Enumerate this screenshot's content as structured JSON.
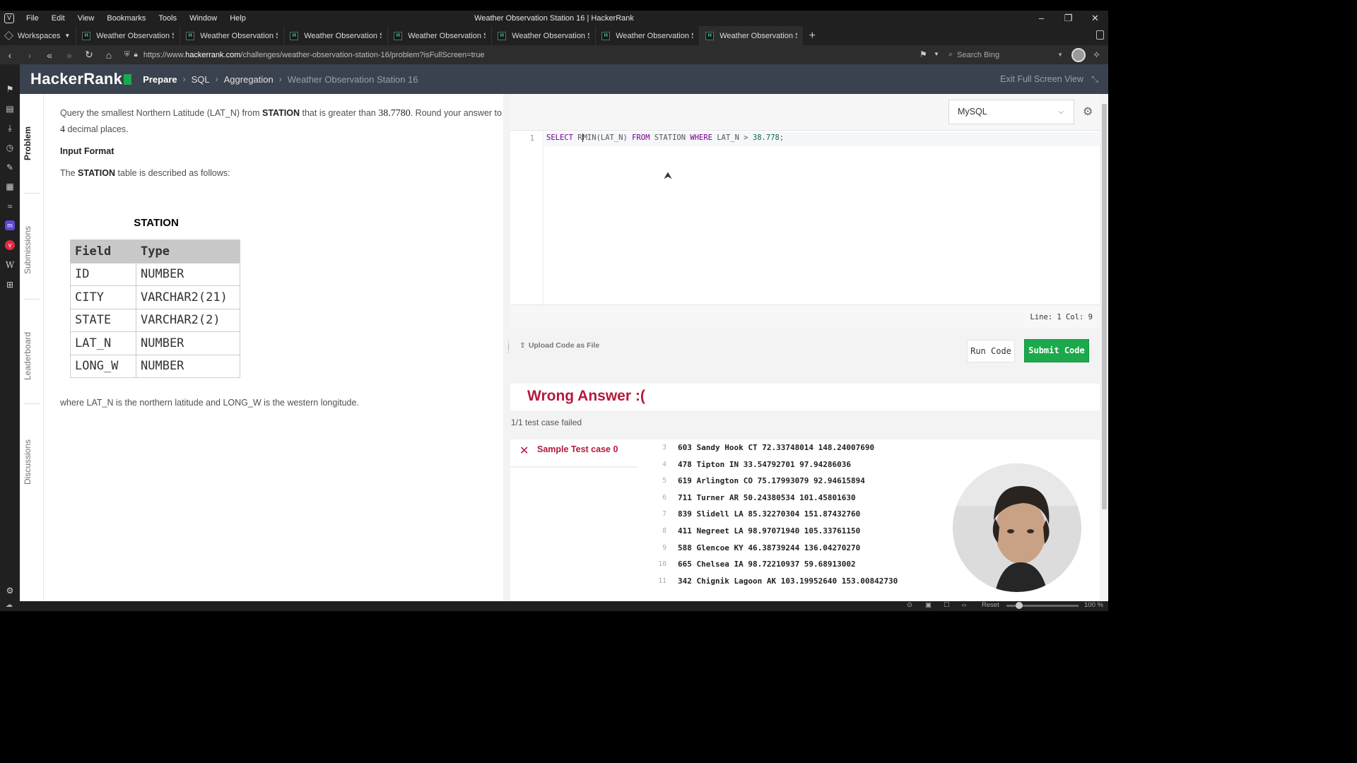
{
  "menubar": {
    "items": [
      "File",
      "Edit",
      "View",
      "Bookmarks",
      "Tools",
      "Window",
      "Help"
    ],
    "window_title": "Weather Observation Station 16 | HackerRank"
  },
  "tabs": {
    "workspaces_label": "Workspaces",
    "items": [
      "Weather Observation Statio",
      "Weather Observation Statio",
      "Weather Observation Statio",
      "Weather Observation Statio",
      "Weather Observation Statio",
      "Weather Observation Statio",
      "Weather Observation Statio"
    ],
    "active_index": 6
  },
  "address": {
    "url_prefix": "https://www.",
    "url_domain": "hackerrank.com",
    "url_path": "/challenges/weather-observation-station-16/problem?isFullScreen=true",
    "search_placeholder": "Search Bing"
  },
  "hr_header": {
    "logo": "HackerRank",
    "breadcrumb": [
      "Prepare",
      "SQL",
      "Aggregation",
      "Weather Observation Station 16"
    ],
    "exit_fullscreen": "Exit Full Screen View"
  },
  "vertical_tabs": [
    "Problem",
    "Submissions",
    "Leaderboard",
    "Discussions"
  ],
  "problem": {
    "p1_a": "Query the smallest Northern Latitude (LAT_N) from",
    "p1_b": "STATION",
    "p1_c": "that is greater than",
    "p1_num": "38.7780",
    "p1_d": ". Round your answer to",
    "p1_num2": "4",
    "p1_e": "decimal places.",
    "input_format": "Input Format",
    "p2_a": "The",
    "p2_b": "STATION",
    "p2_c": "table is described as follows:",
    "table_caption": "STATION",
    "table_headers": [
      "Field",
      "Type"
    ],
    "table_rows": [
      [
        "ID",
        "NUMBER"
      ],
      [
        "CITY",
        "VARCHAR2(21)"
      ],
      [
        "STATE",
        "VARCHAR2(2)"
      ],
      [
        "LAT_N",
        "NUMBER"
      ],
      [
        "LONG_W",
        "NUMBER"
      ]
    ],
    "footer": "where LAT_N is the northern latitude and LONG_W is the western longitude."
  },
  "editor": {
    "language": "MySQL",
    "line_number": "1",
    "code_before_cursor": "R",
    "status": "Line: 1 Col: 9",
    "upload_label": "Upload Code as File",
    "run_label": "Run Code",
    "submit_label": "Submit Code"
  },
  "result": {
    "title": "Wrong Answer :(",
    "summary": "1/1 test case failed",
    "test_case_label": "Sample Test case 0",
    "output_lines": [
      {
        "n": "3",
        "t": "603 Sandy Hook CT 72.33748014 148.24007690"
      },
      {
        "n": "4",
        "t": "478 Tipton IN 33.54792701 97.94286036"
      },
      {
        "n": "5",
        "t": "619 Arlington CO 75.17993079 92.94615894"
      },
      {
        "n": "6",
        "t": "711 Turner AR 50.24380534 101.45801630"
      },
      {
        "n": "7",
        "t": "839 Slidell LA 85.32270304 151.87432760"
      },
      {
        "n": "8",
        "t": "411 Negreet LA 98.97071940 105.33761150"
      },
      {
        "n": "9",
        "t": "588 Glencoe KY 46.38739244 136.04270270"
      },
      {
        "n": "10",
        "t": "665 Chelsea IA 98.72210937 59.68913002"
      },
      {
        "n": "11",
        "t": "342 Chignik Lagoon AK 103.19952640 153.00842730"
      }
    ]
  },
  "bottom": {
    "reset": "Reset",
    "zoom": "100 %"
  }
}
